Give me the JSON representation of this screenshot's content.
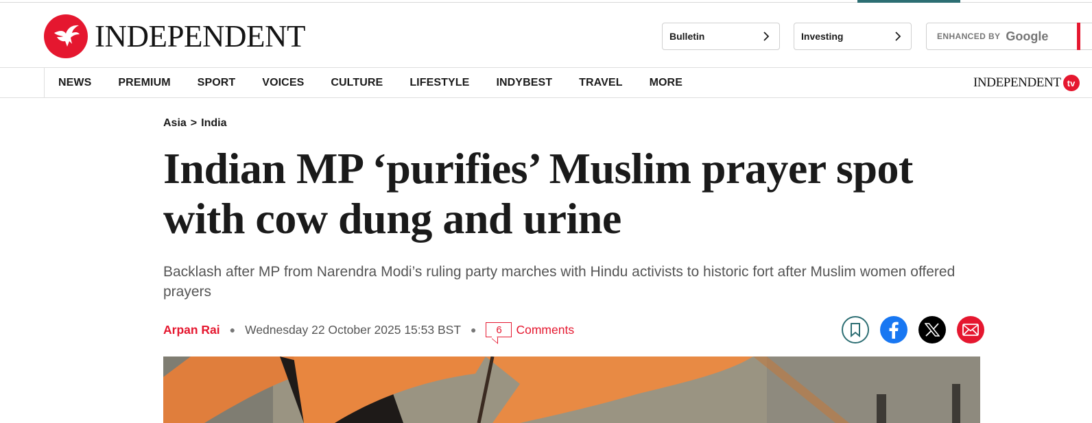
{
  "brand": {
    "name": "INDEPENDENT",
    "tv_wordmark": "INDEPENDENT",
    "tv_badge": "tv",
    "accent": "#e5172f",
    "teal": "#2c6e73"
  },
  "header": {
    "bulletin_label": "Bulletin",
    "investing_label": "Investing",
    "search": {
      "enhanced_by": "ENHANCED BY",
      "provider": "Google"
    }
  },
  "nav": {
    "items": [
      "NEWS",
      "PREMIUM",
      "SPORT",
      "VOICES",
      "CULTURE",
      "LIFESTYLE",
      "INDYBEST",
      "TRAVEL",
      "MORE"
    ]
  },
  "article": {
    "breadcrumb": {
      "parent": "Asia",
      "separator": ">",
      "current": "India"
    },
    "headline": "Indian MP ‘purifies’ Muslim prayer spot with cow dung and urine",
    "standfirst": "Backlash after MP from Narendra Modi’s ruling party marches with Hindu activists to historic fort after Muslim women offered prayers",
    "byline": {
      "author": "Arpan Rai",
      "date": "Wednesday 22 October 2025 15:53 BST",
      "comment_count": "6",
      "comments_label": "Comments"
    },
    "share": [
      "bookmark-icon",
      "facebook-icon",
      "x-icon",
      "email-icon"
    ]
  }
}
